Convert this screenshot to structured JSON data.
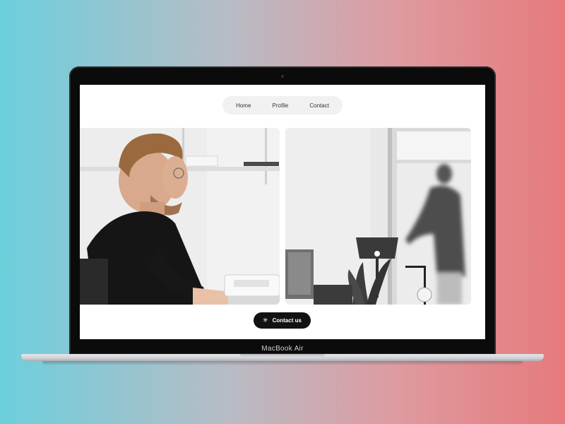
{
  "device": {
    "label": "MacBook Air"
  },
  "nav": {
    "items": [
      {
        "label": "Home"
      },
      {
        "label": "Profile"
      },
      {
        "label": "Contact"
      }
    ]
  },
  "cta": {
    "label": "Contact us",
    "icon": "sparkle-icon"
  },
  "colors": {
    "background_left": "#6ccfdc",
    "background_right": "#e67a7c",
    "cta_background": "#121212",
    "nav_background": "#f1f1f1"
  }
}
